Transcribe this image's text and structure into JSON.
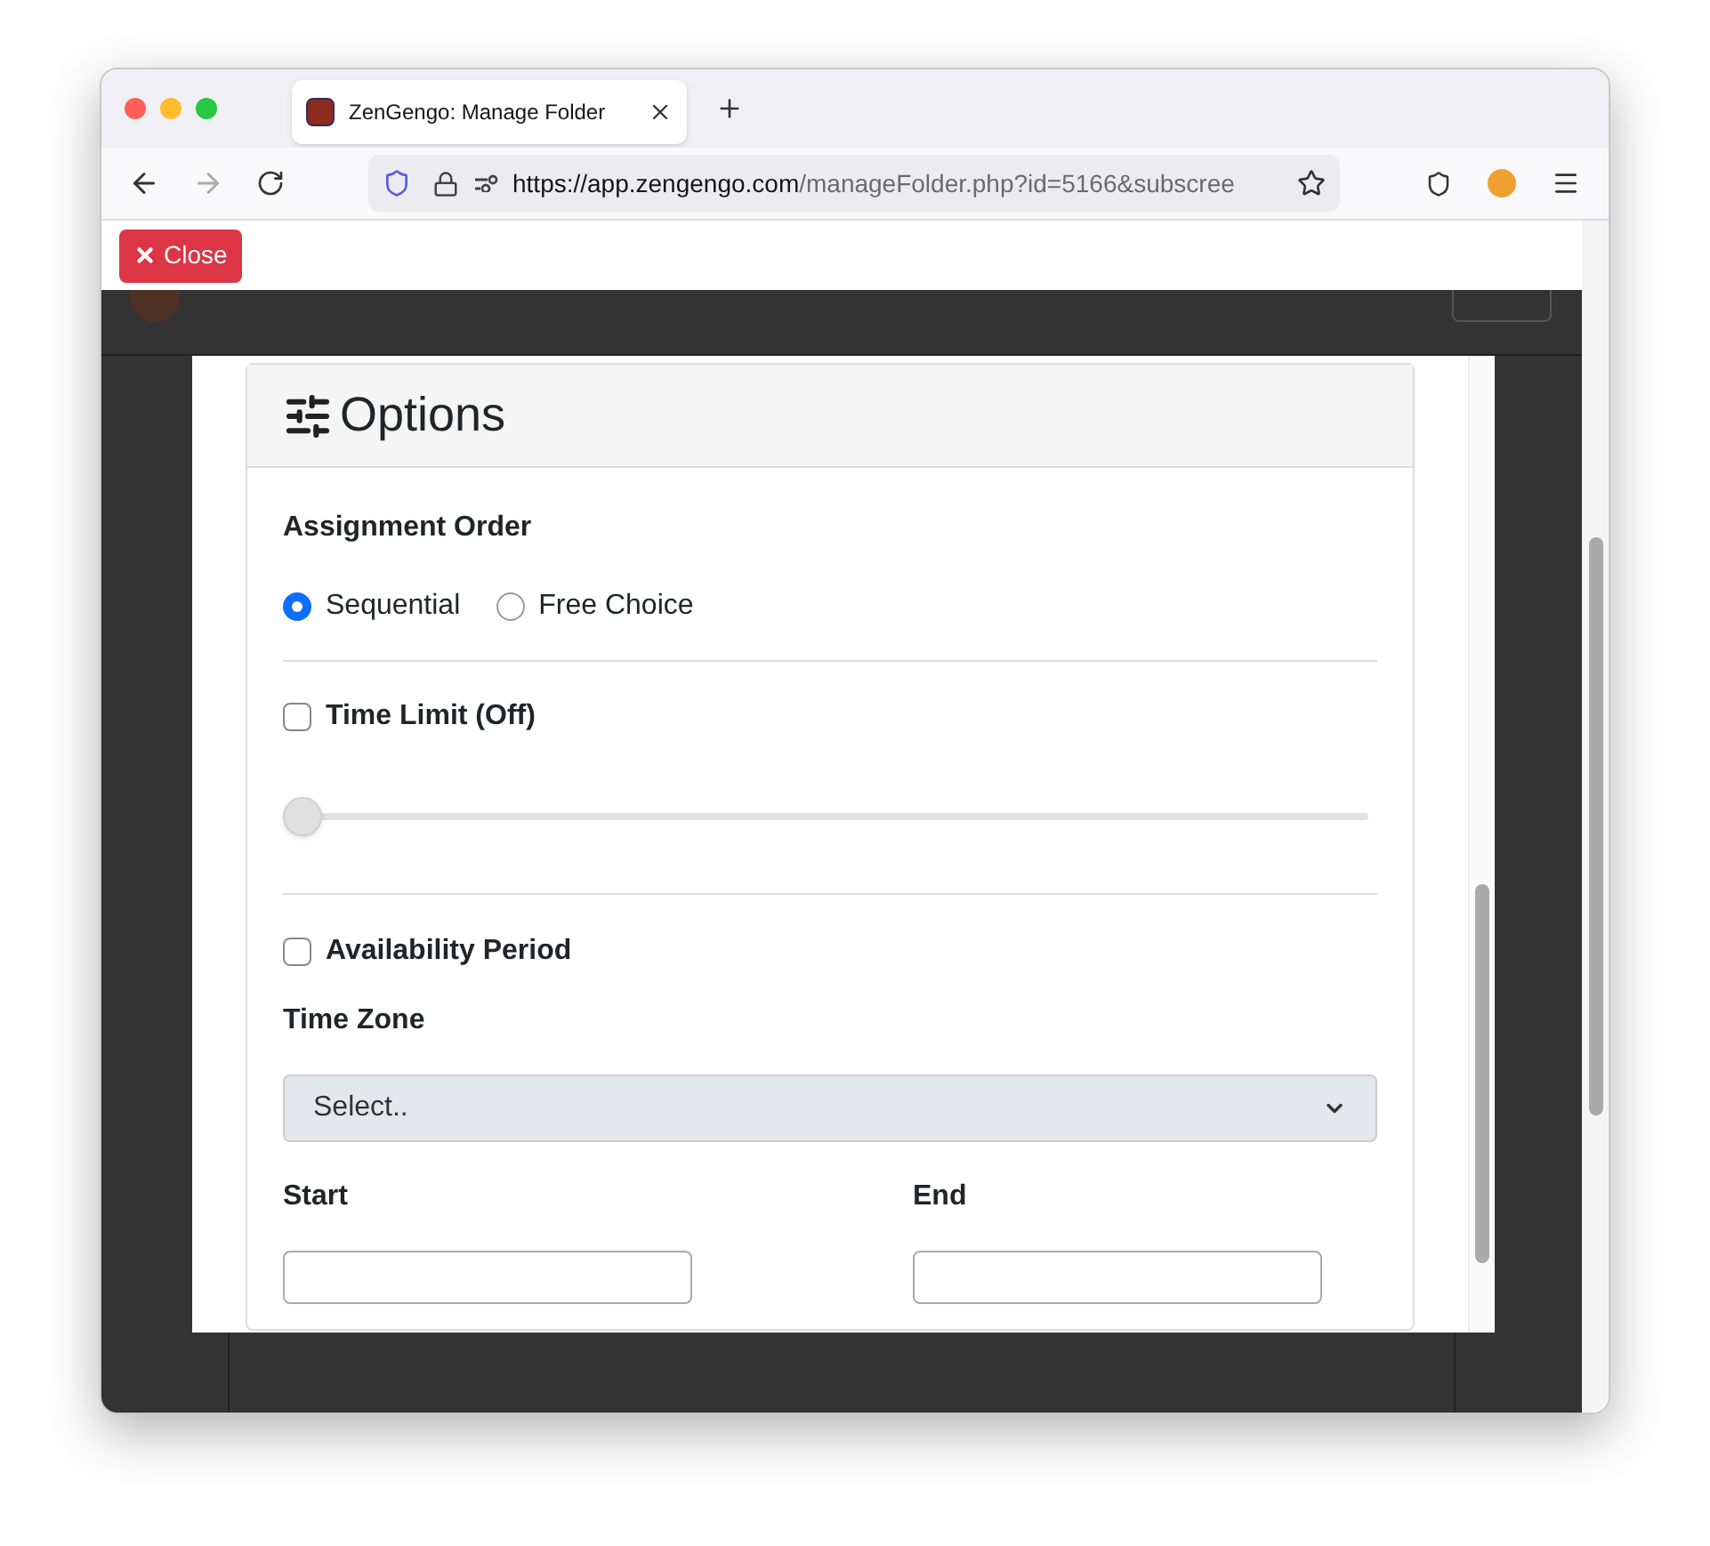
{
  "browser": {
    "tab_title": "ZenGengo: Manage Folder",
    "url_host": "https://app.zengengo.com",
    "url_path": "/manageFolder.php?id=5166&subscree"
  },
  "close_button": "Close",
  "options": {
    "title": "Options",
    "assignment_order": {
      "label": "Assignment Order",
      "choices": [
        {
          "label": "Sequential",
          "selected": true
        },
        {
          "label": "Free Choice",
          "selected": false
        }
      ]
    },
    "time_limit": {
      "label": "Time Limit (Off)",
      "checked": false,
      "level": 0
    },
    "availability": {
      "label": "Availability Period",
      "checked": false
    },
    "time_zone": {
      "label": "Time Zone",
      "value": "Select.."
    },
    "start": {
      "label": "Start"
    },
    "end": {
      "label": "End"
    }
  }
}
